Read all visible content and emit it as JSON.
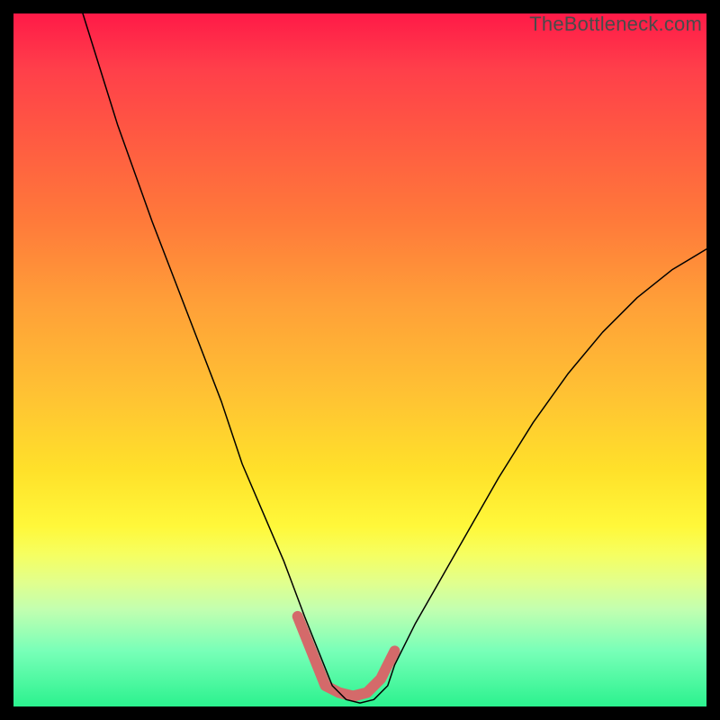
{
  "watermark": "TheBottleneck.com",
  "chart_data": {
    "type": "line",
    "title": "",
    "xlabel": "",
    "ylabel": "",
    "xlim": [
      0,
      100
    ],
    "ylim": [
      0,
      100
    ],
    "series": [
      {
        "name": "curve",
        "x": [
          10,
          15,
          20,
          25,
          30,
          33,
          36,
          39,
          42,
          44,
          46,
          48,
          50,
          52,
          54,
          55,
          58,
          62,
          66,
          70,
          75,
          80,
          85,
          90,
          95,
          100
        ],
        "y": [
          100,
          84,
          70,
          57,
          44,
          35,
          28,
          21,
          13,
          8,
          3,
          1,
          0.5,
          1,
          3,
          6,
          12,
          19,
          26,
          33,
          41,
          48,
          54,
          59,
          63,
          66
        ]
      },
      {
        "name": "highlight",
        "x": [
          41,
          43,
          45,
          47,
          49,
          51,
          53,
          55
        ],
        "y": [
          13,
          8,
          3,
          2,
          1.5,
          2,
          4,
          8
        ]
      }
    ],
    "colors": {
      "curve_stroke": "#000000",
      "highlight_stroke": "#d46a6a"
    },
    "stroke_width": {
      "curve": 1.5,
      "highlight": 12
    }
  }
}
